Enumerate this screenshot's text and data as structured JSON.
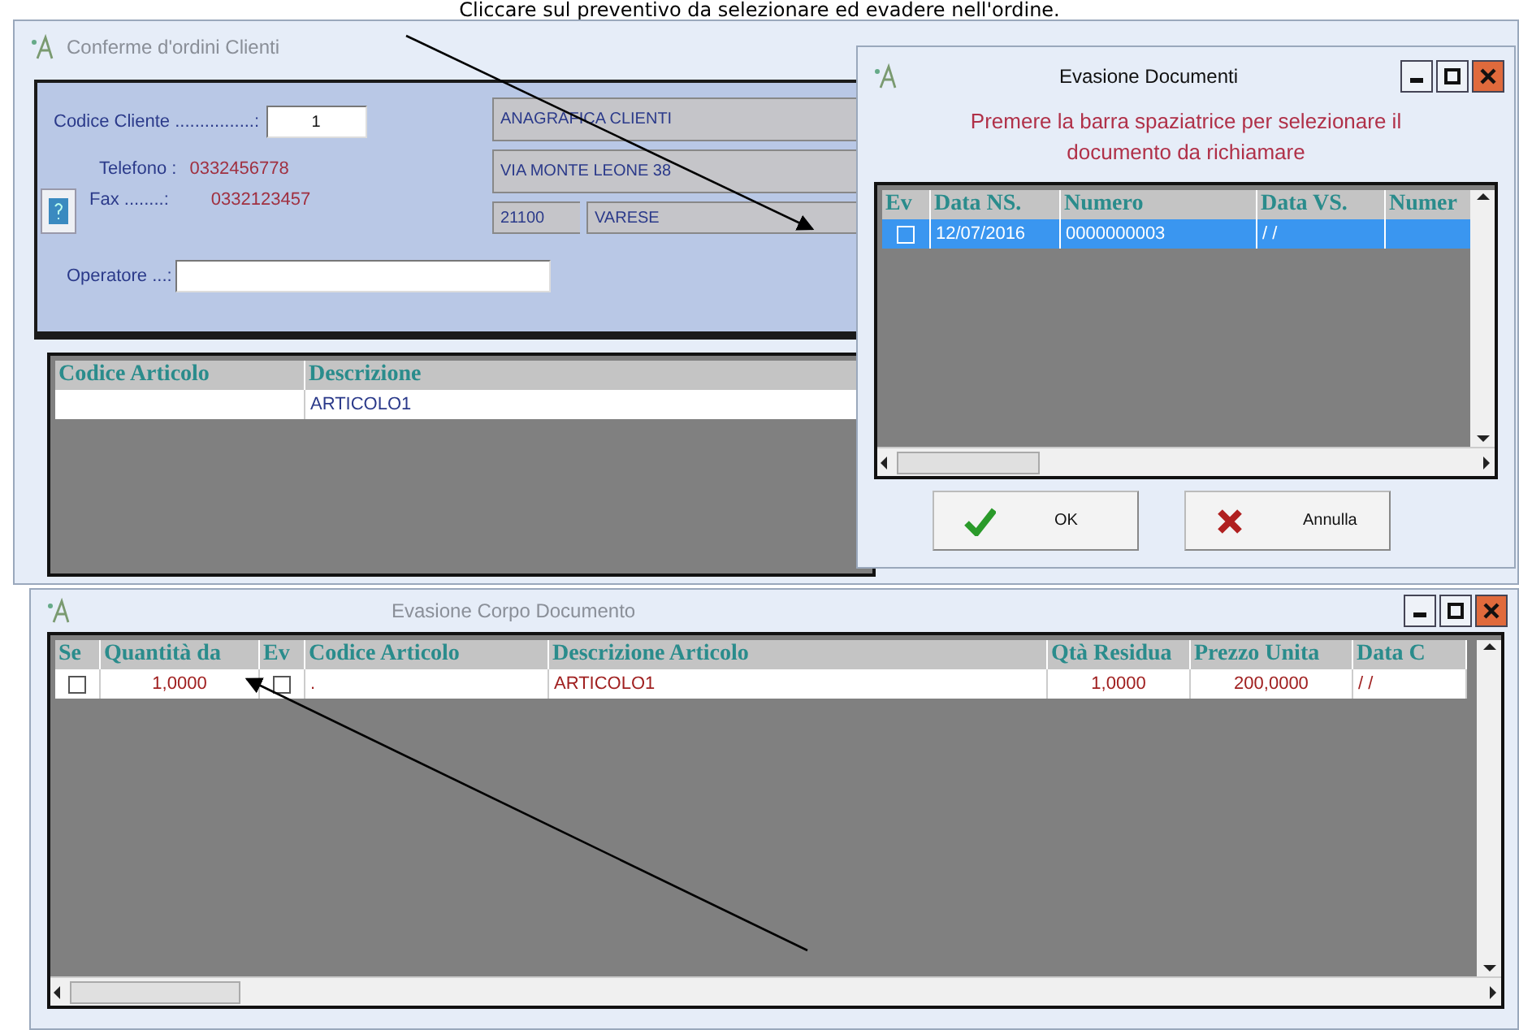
{
  "caption": "Cliccare sul preventivo da selezionare ed evadere nell'ordine.",
  "main_window": {
    "title": "Conferme d'ordini Clienti",
    "customer": {
      "code_label": "Codice Cliente ................:",
      "code_value": "1",
      "phone_label": "Telefono :",
      "phone_value": "0332456778",
      "fax_label": "Fax ........:",
      "fax_value": "0332123457",
      "operator_label": "Operatore ...:",
      "name": "ANAGRAFICA CLIENTI",
      "address": "VIA MONTE LEONE 38",
      "zip": "21100",
      "city": "VARESE"
    },
    "grid": {
      "columns": [
        "Codice Articolo",
        "Descrizione"
      ],
      "rows": [
        {
          "cells": [
            "",
            "ARTICOLO1"
          ]
        }
      ]
    }
  },
  "dialog": {
    "title": "Evasione Documenti",
    "message": "Premere la barra spaziatrice per selezionare il documento da richiamare",
    "grid": {
      "columns": [
        "Ev",
        "Data NS.",
        "Numero",
        "Data VS.",
        "Numer"
      ],
      "rows": [
        {
          "selected": true,
          "checked": false,
          "cells": [
            "",
            "12/07/2016",
            "0000000003",
            "/ /",
            ""
          ]
        }
      ]
    },
    "buttons": [
      {
        "kind": "ok",
        "label": "OK"
      },
      {
        "kind": "cancel",
        "label": "Annulla"
      }
    ]
  },
  "detail_window": {
    "title": "Evasione Corpo Documento",
    "grid": {
      "columns": [
        "Se",
        "Quantità da",
        "Ev",
        "Codice Articolo",
        "Descrizione Articolo",
        "Qtà Residua",
        "Prezzo Unita",
        "Data C"
      ],
      "rows": [
        {
          "checked": false,
          "ev_checked": false,
          "cells": [
            "",
            "1,0000",
            "",
            ".",
            "ARTICOLO1",
            "1,0000",
            "200,0000",
            "/ /"
          ]
        }
      ]
    }
  }
}
